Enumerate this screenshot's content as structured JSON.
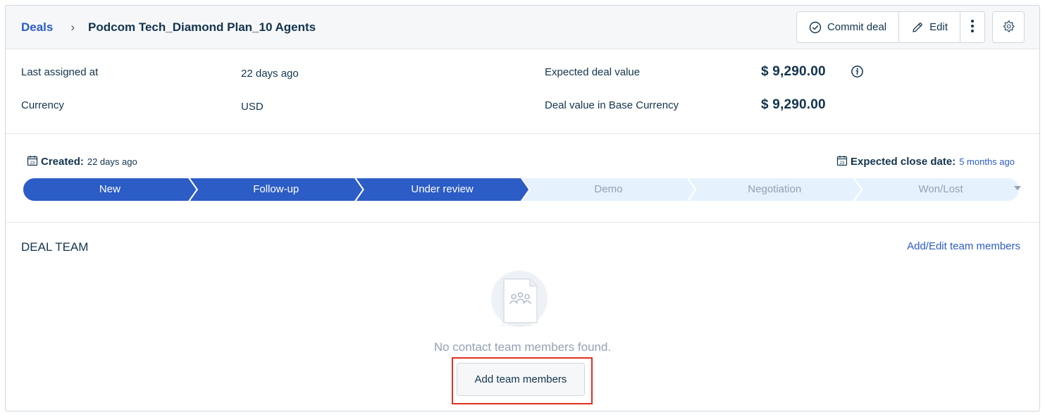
{
  "breadcrumb": {
    "root": "Deals",
    "separator": "›",
    "title": "Podcom Tech_Diamond Plan_10 Agents"
  },
  "actions": {
    "commit_label": "Commit deal",
    "edit_label": "Edit"
  },
  "details": {
    "last_assigned_label": "Last assigned at",
    "last_assigned_value": "22 days ago",
    "currency_label": "Currency",
    "currency_value": "USD",
    "expected_value_label": "Expected deal value",
    "expected_value": "$ 9,290.00",
    "base_value_label": "Deal value in Base Currency",
    "base_value": "$ 9,290.00"
  },
  "pipeline": {
    "created_label": "Created:",
    "created_value": "22 days ago",
    "close_label": "Expected close date:",
    "close_value": "5 months ago",
    "stages": [
      {
        "label": "New",
        "active": true
      },
      {
        "label": "Follow-up",
        "active": true
      },
      {
        "label": "Under review",
        "active": true
      },
      {
        "label": "Demo",
        "active": false
      },
      {
        "label": "Negotiation",
        "active": false
      },
      {
        "label": "Won/Lost",
        "active": false
      }
    ],
    "colors": {
      "active": "#2c5cc5",
      "inactive": "#e5f2fd",
      "active_text": "#ffffff",
      "inactive_text": "#92a2b1"
    }
  },
  "team": {
    "title": "DEAL TEAM",
    "edit_link": "Add/Edit team members",
    "empty_text": "No contact team members found.",
    "add_button": "Add team members"
  },
  "icons": {
    "commit": "check-circle-icon",
    "edit": "pencil-icon",
    "more": "kebab-menu-icon",
    "settings": "gear-icon",
    "info": "info-icon",
    "calendar": "calendar-icon",
    "dropdown": "caret-down-icon"
  }
}
